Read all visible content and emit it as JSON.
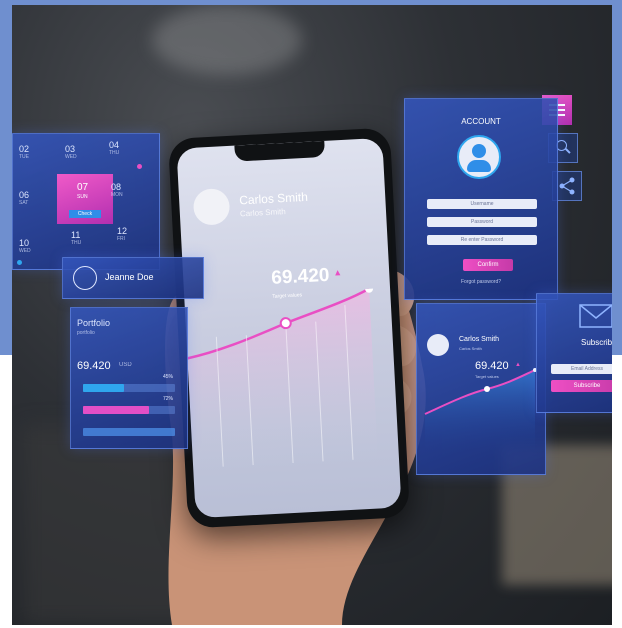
{
  "calendar": {
    "days": [
      {
        "num": "02",
        "sub": "TUE"
      },
      {
        "num": "03",
        "sub": "WED"
      },
      {
        "num": "04",
        "sub": "THU"
      },
      {
        "num": "06",
        "sub": "SAT"
      },
      {
        "num": "07",
        "sub": "SUN"
      },
      {
        "num": "08",
        "sub": "MON"
      },
      {
        "num": "10",
        "sub": "WED"
      },
      {
        "num": "11",
        "sub": "THU"
      },
      {
        "num": "12",
        "sub": "FRI"
      }
    ],
    "check_label": "Check"
  },
  "contact": {
    "name": "Jeanne Doe"
  },
  "portfolio": {
    "title": "Portfolio",
    "subtitle": "portfolio",
    "value": "69.420",
    "currency": "USD",
    "bars": [
      {
        "label": "45%",
        "fraction": 0.45,
        "color": "#2fa6ee"
      },
      {
        "label": "72%",
        "fraction": 0.72,
        "color": "#e24fc6"
      },
      {
        "label": "",
        "fraction": 0.0,
        "color": "#3a8ee8"
      }
    ]
  },
  "phone": {
    "name": "Carlos Smith",
    "subtitle": "Carlos Smith",
    "value": "69.420",
    "caption": "Target values"
  },
  "account": {
    "title": "ACCOUNT",
    "fields": [
      "Username",
      "Password",
      "Re enter Password"
    ],
    "confirm_label": "Confirm",
    "forgot_label": "Forgot password?"
  },
  "mini_chart": {
    "name": "Carlos Smith",
    "subtitle": "Carlos Smith",
    "value": "69.420",
    "caption": "Target values"
  },
  "subscribe": {
    "title": "Subscribe",
    "email_placeholder": "Email Address",
    "button_label": "Subscribe"
  },
  "colors": {
    "accent_pink": "#e94fc4",
    "accent_blue": "#2f5ac0",
    "frame_blue": "#6f8fcf"
  },
  "icons": [
    "menu-icon",
    "search-icon",
    "share-icon",
    "user-icon",
    "envelope-icon"
  ]
}
